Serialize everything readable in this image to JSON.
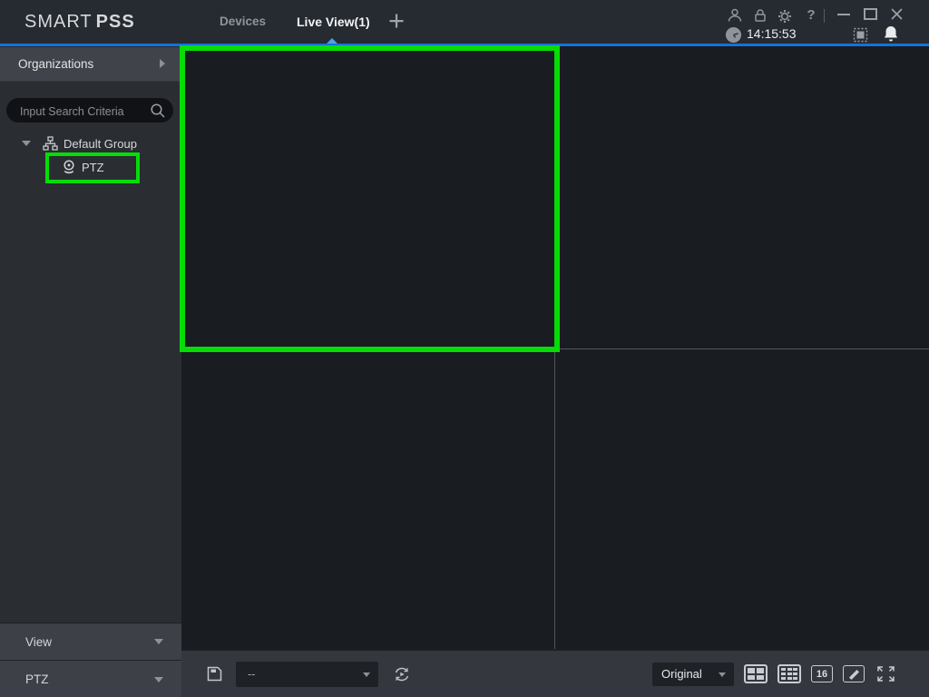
{
  "colors": {
    "accent_blue": "#1472d8",
    "highlight_green": "#06dc06",
    "topbar_bg": "#262a31",
    "sidebar_bg": "#2a2d32",
    "pane_bg": "#191c21"
  },
  "titlebar": {
    "brand": {
      "light": "SMART",
      "bold": "PSS"
    },
    "tabs": {
      "devices": "Devices",
      "live_view": "Live View(1)",
      "add": "+"
    },
    "help": "?",
    "clock": {
      "time": "14:15:53"
    }
  },
  "sidebar": {
    "header": {
      "title": "Organizations"
    },
    "search": {
      "placeholder": "Input Search Criteria"
    },
    "tree": {
      "group_label": "Default Group",
      "device_label": "PTZ"
    },
    "panels": {
      "view": "View",
      "ptz": "PTZ"
    }
  },
  "toolbar": {
    "stream_select": {
      "value": "--"
    },
    "scale_select": {
      "value": "Original"
    },
    "split16_label": "16"
  }
}
